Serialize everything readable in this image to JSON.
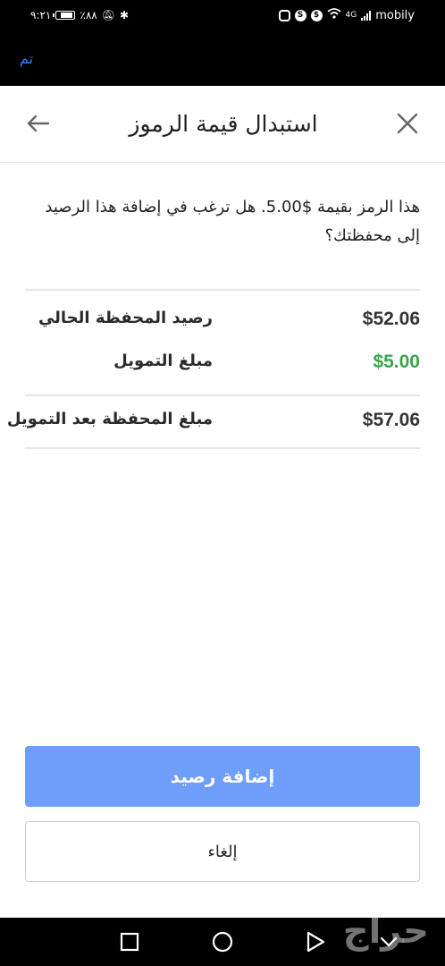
{
  "status_bar": {
    "time": "٩:٢١",
    "battery_percent": "٪٨٨",
    "carrier": "mobily",
    "network": "4G"
  },
  "top_bar": {
    "done_label": "تم",
    "done_color": "#2f80ff"
  },
  "dialog": {
    "title": "استبدال قيمة الرموز",
    "close_icon": "close-icon",
    "back_icon": "arrow-left-icon",
    "message": "هذا الرمز بقيمة $5.00. هل ترغب في إضافة هذا الرصيد إلى محفظتك؟",
    "rows": [
      {
        "label": "رصيد المحفظة الحالي",
        "amount": "$52.06"
      },
      {
        "label": "مبلغ التمويل",
        "amount": "$5.00"
      },
      {
        "label": "مبلغ المحفظة بعد التمويل",
        "amount": "$57.06"
      }
    ],
    "amount_green": "#3aa64a",
    "primary_button": "إضافة رصيد",
    "primary_color": "#6e9ef9",
    "secondary_button": "إلغاء"
  },
  "watermark": "حراج"
}
